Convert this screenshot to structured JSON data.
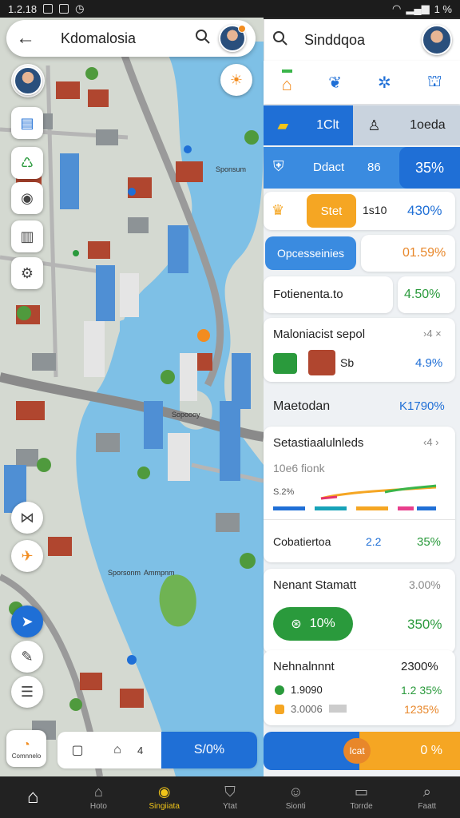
{
  "status_bar": {
    "time": "1.2.18",
    "battery": "1 %"
  },
  "left_header": {
    "title": "Kdomalosia"
  },
  "right_header": {
    "title": "Sinddqoa"
  },
  "map": {
    "labels": [
      "Sponsum",
      "Sopoooy",
      "Sporsonm",
      "Ammpnm"
    ]
  },
  "map_bottom": {
    "corner_label": "Comnnelo",
    "stepper_value": "4",
    "percent": "S/0%"
  },
  "panel": {
    "icon_tabs": [
      "home-tab-icon",
      "leaf-tab-icon",
      "gear-tab-icon",
      "building-tab-icon"
    ],
    "row1": {
      "left": "1Clt",
      "right": "1oeda"
    },
    "row2": {
      "label": "Ddact",
      "mid": "86",
      "value": "35%"
    },
    "row3": {
      "button": "Stet",
      "mid": "1s10",
      "value": "430%"
    },
    "row4": {
      "button": "Opcesseinies",
      "value": "01.59%"
    },
    "row5": {
      "label": "Fotienenta.to",
      "value": "4.50%"
    },
    "card1": {
      "title": "Maloniacist sepol",
      "arrows": "›4 ×",
      "item": "Sb",
      "value": "4.9%"
    },
    "card2": {
      "label": "Maetodan",
      "value": "K1790%"
    },
    "card3": {
      "title": "Setastiaalulnleds",
      "arrows": "‹4 ›",
      "subtitle": "10e6 fionk",
      "chart_label": "S.2%",
      "footer_label": "Cobatiertoa",
      "footer_mid": "2.2",
      "footer_value": "35%"
    },
    "card4": {
      "title": "Nenant Stamatt",
      "grey_value": "3.00%",
      "pill": "10%",
      "value": "350%"
    },
    "card5": {
      "title": "Nehnalnnnt",
      "value": "2300%",
      "row1_label": "1.9090",
      "row1_value": "1.2 35%",
      "row2_label": "3.0006",
      "row2_value": "1235%"
    },
    "bottom_bar": {
      "left": "Icat",
      "right": "0 %"
    }
  },
  "bottom_nav": {
    "items": [
      {
        "label": "",
        "icon": "home-icon"
      },
      {
        "label": "Hoto",
        "icon": "house-outline-icon"
      },
      {
        "label": "Singiiata",
        "icon": "map-pin-icon"
      },
      {
        "label": "Ytat",
        "icon": "shield-icon"
      },
      {
        "label": "Sionti",
        "icon": "people-icon"
      },
      {
        "label": "Torrde",
        "icon": "inbox-icon"
      },
      {
        "label": "Faatt",
        "icon": "search-icon"
      }
    ]
  },
  "colors": {
    "accent": "#1f6fd6",
    "orange": "#f5a623",
    "green": "#2a9a3c",
    "water": "#7ec0e6"
  }
}
